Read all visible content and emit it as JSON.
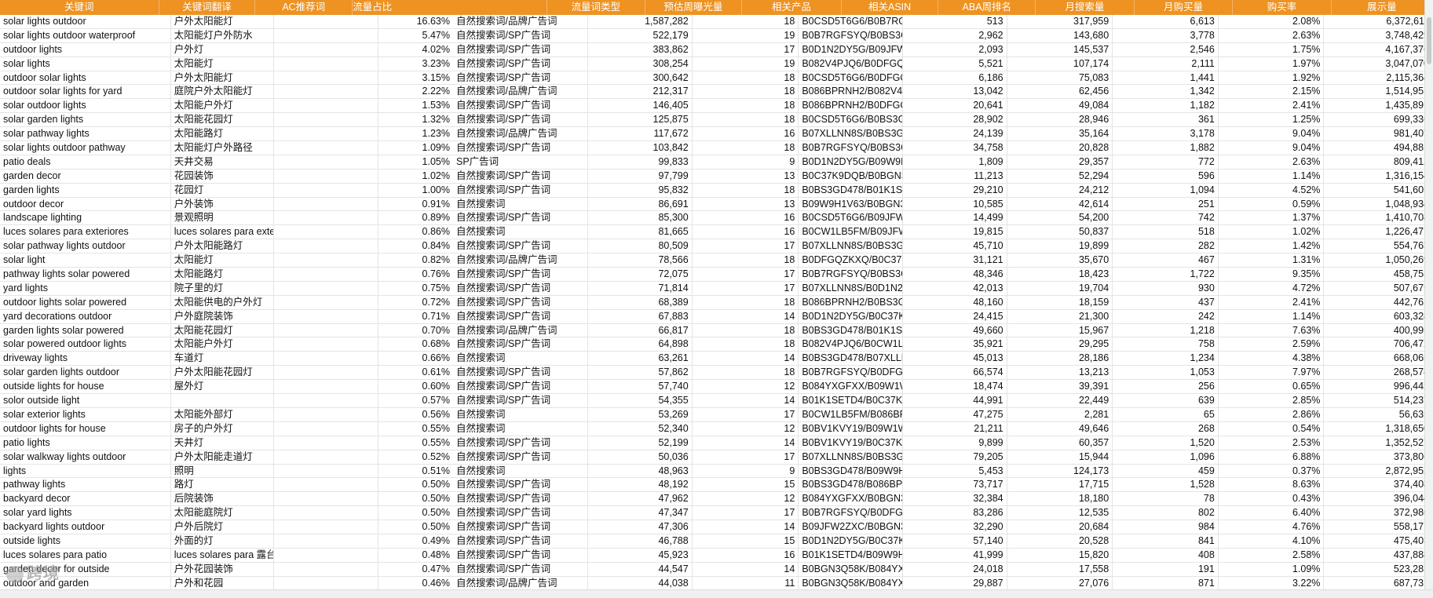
{
  "headers": [
    "关键词",
    "关键词翻译",
    "AC推荐词",
    "流量占比",
    "流量词类型",
    "预估周曝光量",
    "相关产品",
    "相关ASIN",
    "ABA周排名",
    "月搜索量",
    "月购买量",
    "购买率",
    "展示量"
  ],
  "rows": [
    [
      "solar lights outdoor",
      "户外太阳能灯",
      "",
      "16.63%",
      "自然搜索词/品牌广告词",
      "1,587,282",
      "18",
      "B0CSD5T6G6/B0B7RGF",
      "513",
      "317,959",
      "6,613",
      "2.08%",
      "6,372,611"
    ],
    [
      "solar lights outdoor waterproof",
      "太阳能灯户外防水",
      "",
      "5.47%",
      "自然搜索词/SP广告词",
      "522,179",
      "19",
      "B0B7RGFSYQ/B0BS3GD",
      "2,962",
      "143,680",
      "3,778",
      "2.63%",
      "3,748,429"
    ],
    [
      "outdoor lights",
      "户外灯",
      "",
      "4.02%",
      "自然搜索词/SP广告词",
      "383,862",
      "17",
      "B0D1N2DY5G/B09JFW2",
      "2,093",
      "145,537",
      "2,546",
      "1.75%",
      "4,167,376"
    ],
    [
      "solar lights",
      "太阳能灯",
      "",
      "3.23%",
      "自然搜索词/SP广告词",
      "308,254",
      "19",
      "B082V4PJQ6/B0DFGQZ",
      "5,521",
      "107,174",
      "2,111",
      "1.97%",
      "3,047,070"
    ],
    [
      "outdoor solar lights",
      "户外太阳能灯",
      "",
      "3.15%",
      "自然搜索词/SP广告词",
      "300,642",
      "18",
      "B0CSD5T6G6/B0DFGQZ",
      "6,186",
      "75,083",
      "1,441",
      "1.92%",
      "2,115,364"
    ],
    [
      "outdoor solar lights for yard",
      "庭院户外太阳能灯",
      "",
      "2.22%",
      "自然搜索词/品牌广告词",
      "212,317",
      "18",
      "B086BPRNH2/B082V4P",
      "13,042",
      "62,456",
      "1,342",
      "2.15%",
      "1,514,951"
    ],
    [
      "solar outdoor lights",
      "太阳能户外灯",
      "",
      "1.53%",
      "自然搜索词/SP广告词",
      "146,405",
      "18",
      "B086BPRNH2/B0DFGQZ",
      "20,641",
      "49,084",
      "1,182",
      "2.41%",
      "1,435,891"
    ],
    [
      "solar garden lights",
      "太阳能花园灯",
      "",
      "1.32%",
      "自然搜索词/SP广告词",
      "125,875",
      "18",
      "B0CSD5T6G6/B0BS3GD",
      "28,902",
      "28,946",
      "361",
      "1.25%",
      "699,336"
    ],
    [
      "solar pathway lights",
      "太阳能路灯",
      "",
      "1.23%",
      "自然搜索词/品牌广告词",
      "117,672",
      "16",
      "B07XLLNN8S/B0BS3GD",
      "24,139",
      "35,164",
      "3,178",
      "9.04%",
      "981,407"
    ],
    [
      "solar lights outdoor pathway",
      "太阳能灯户外路径",
      "",
      "1.09%",
      "自然搜索词/SP广告词",
      "103,842",
      "18",
      "B0B7RGFSYQ/B0BS3GD",
      "34,758",
      "20,828",
      "1,882",
      "9.04%",
      "494,881"
    ],
    [
      "patio deals",
      "天井交易",
      "",
      "1.05%",
      "SP广告词",
      "99,833",
      "9",
      "B0D1N2DY5G/B09W9H",
      "1,809",
      "29,357",
      "772",
      "2.63%",
      "809,412"
    ],
    [
      "garden decor",
      "花园装饰",
      "",
      "1.02%",
      "自然搜索词/SP广告词",
      "97,799",
      "13",
      "B0C37K9DQB/B0BGN3C",
      "11,213",
      "52,294",
      "596",
      "1.14%",
      "1,316,154"
    ],
    [
      "garden lights",
      "花园灯",
      "",
      "1.00%",
      "自然搜索词/SP广告词",
      "95,832",
      "18",
      "B0BS3GD478/B01K1SET",
      "29,210",
      "24,212",
      "1,094",
      "4.52%",
      "541,605"
    ],
    [
      "outdoor decor",
      "户外装饰",
      "",
      "0.91%",
      "自然搜索词",
      "86,691",
      "13",
      "B09W9H1V63/B0BGN3C",
      "10,585",
      "42,614",
      "251",
      "0.59%",
      "1,048,934"
    ],
    [
      "landscape lighting",
      "景观照明",
      "",
      "0.89%",
      "自然搜索词/SP广告词",
      "85,300",
      "16",
      "B0CSD5T6G6/B09JFW2",
      "14,499",
      "54,200",
      "742",
      "1.37%",
      "1,410,708"
    ],
    [
      "luces solares para exteriores",
      "luces solares para exter",
      "",
      "0.86%",
      "自然搜索词",
      "81,665",
      "16",
      "B0CW1LB5FM/B09JFW2",
      "19,815",
      "50,837",
      "518",
      "1.02%",
      "1,226,471"
    ],
    [
      "solar pathway lights outdoor",
      "户外太阳能路灯",
      "",
      "0.84%",
      "自然搜索词/SP广告词",
      "80,509",
      "17",
      "B07XLLNN8S/B0BS3GD",
      "45,710",
      "19,899",
      "282",
      "1.42%",
      "554,763"
    ],
    [
      "solar light",
      "太阳能灯",
      "",
      "0.82%",
      "自然搜索词/品牌广告词",
      "78,566",
      "18",
      "B0DFGQZKXQ/B0C37K9",
      "31,121",
      "35,670",
      "467",
      "1.31%",
      "1,050,269"
    ],
    [
      "pathway lights solar powered",
      "太阳能路灯",
      "",
      "0.76%",
      "自然搜索词/SP广告词",
      "72,075",
      "17",
      "B0B7RGFSYQ/B0BS3GD",
      "48,346",
      "18,423",
      "1,722",
      "9.35%",
      "458,753"
    ],
    [
      "yard lights",
      "院子里的灯",
      "",
      "0.75%",
      "自然搜索词/SP广告词",
      "71,814",
      "17",
      "B07XLLNN8S/B0D1N2D",
      "42,013",
      "19,704",
      "930",
      "4.72%",
      "507,675"
    ],
    [
      "outdoor lights solar powered",
      "太阳能供电的户外灯",
      "",
      "0.72%",
      "自然搜索词/SP广告词",
      "68,389",
      "18",
      "B086BPRNH2/B0BS3GD",
      "48,160",
      "18,159",
      "437",
      "2.41%",
      "442,761"
    ],
    [
      "yard decorations outdoor",
      "户外庭院装饰",
      "",
      "0.71%",
      "自然搜索词/SP广告词",
      "67,883",
      "14",
      "B0D1N2DY5G/B0C37K9",
      "24,415",
      "21,300",
      "242",
      "1.14%",
      "603,328"
    ],
    [
      "garden lights solar powered",
      "太阳能花园灯",
      "",
      "0.70%",
      "自然搜索词/品牌广告词",
      "66,817",
      "18",
      "B0BS3GD478/B01K1SET",
      "49,660",
      "15,967",
      "1,218",
      "7.63%",
      "400,995"
    ],
    [
      "solar powered outdoor lights",
      "太阳能户外灯",
      "",
      "0.68%",
      "自然搜索词/SP广告词",
      "64,898",
      "18",
      "B082V4PJQ6/B0CW1LB",
      "35,921",
      "29,295",
      "758",
      "2.59%",
      "706,472"
    ],
    [
      "driveway lights",
      "车道灯",
      "",
      "0.66%",
      "自然搜索词",
      "63,261",
      "14",
      "B0BS3GD478/B07XLLN",
      "45,013",
      "28,186",
      "1,234",
      "4.38%",
      "668,065"
    ],
    [
      "solar garden lights outdoor",
      "户外太阳能花园灯",
      "",
      "0.61%",
      "自然搜索词/SP广告词",
      "57,862",
      "18",
      "B0B7RGFSYQ/B0DFGQZ",
      "66,574",
      "13,213",
      "1,053",
      "7.97%",
      "268,578"
    ],
    [
      "outside lights for house",
      "屋外灯",
      "",
      "0.60%",
      "自然搜索词/SP广告词",
      "57,740",
      "12",
      "B084YXGFXX/B09W1WI",
      "18,474",
      "39,391",
      "256",
      "0.65%",
      "996,442"
    ],
    [
      "solor outside light",
      "",
      "",
      "0.57%",
      "自然搜索词/SP广告词",
      "54,355",
      "14",
      "B01K1SETD4/B0C37K9D",
      "44,991",
      "22,449",
      "639",
      "2.85%",
      "514,237"
    ],
    [
      "solar exterior lights",
      "太阳能外部灯",
      "",
      "0.56%",
      "自然搜索词",
      "53,269",
      "17",
      "B0CW1LB5FM/B086BPR",
      "47,275",
      "2,281",
      "65",
      "2.86%",
      "56,635"
    ],
    [
      "outdoor lights for house",
      "房子的户外灯",
      "",
      "0.55%",
      "自然搜索词",
      "52,340",
      "12",
      "B0BV1KVY19/B09W1WI",
      "21,211",
      "49,646",
      "268",
      "0.54%",
      "1,318,650"
    ],
    [
      "patio lights",
      "天井灯",
      "",
      "0.55%",
      "自然搜索词/SP广告词",
      "52,199",
      "14",
      "B0BV1KVY19/B0C37K9D",
      "9,899",
      "60,357",
      "1,520",
      "2.53%",
      "1,352,527"
    ],
    [
      "solar walkway lights outdoor",
      "户外太阳能走道灯",
      "",
      "0.52%",
      "自然搜索词/SP广告词",
      "50,036",
      "17",
      "B07XLLNN8S/B0BS3GD",
      "79,205",
      "15,944",
      "1,096",
      "6.88%",
      "373,806"
    ],
    [
      "lights",
      "照明",
      "",
      "0.51%",
      "自然搜索词",
      "48,963",
      "9",
      "B0BS3GD478/B09W9H1",
      "5,453",
      "124,173",
      "459",
      "0.37%",
      "2,872,952"
    ],
    [
      "pathway lights",
      "路灯",
      "",
      "0.50%",
      "自然搜索词/SP广告词",
      "48,192",
      "15",
      "B0BS3GD478/B086BPRI",
      "73,717",
      "17,715",
      "1,528",
      "8.63%",
      "374,408"
    ],
    [
      "backyard decor",
      "后院装饰",
      "",
      "0.50%",
      "自然搜索词/SP广告词",
      "47,962",
      "12",
      "B084YXGFXX/B0BGN3Q",
      "32,384",
      "18,180",
      "78",
      "0.43%",
      "396,044"
    ],
    [
      "solar yard lights",
      "太阳能庭院灯",
      "",
      "0.50%",
      "自然搜索词/SP广告词",
      "47,347",
      "17",
      "B0B7RGFSYQ/B0DFGQZ",
      "83,286",
      "12,535",
      "802",
      "6.40%",
      "372,986"
    ],
    [
      "backyard lights outdoor",
      "户外后院灯",
      "",
      "0.50%",
      "自然搜索词/SP广告词",
      "47,306",
      "14",
      "B09JFW2ZXC/B0BGN3Q",
      "32,290",
      "20,684",
      "984",
      "4.76%",
      "558,171"
    ],
    [
      "outside lights",
      "外面的灯",
      "",
      "0.49%",
      "自然搜索词/SP广告词",
      "46,788",
      "15",
      "B0D1N2DY5G/B0C37K9",
      "57,140",
      "20,528",
      "841",
      "4.10%",
      "475,403"
    ],
    [
      "luces solares para patio",
      "luces solares para 露台",
      "",
      "0.48%",
      "自然搜索词/SP广告词",
      "45,923",
      "16",
      "B01K1SETD4/B09W9H1",
      "41,999",
      "15,820",
      "408",
      "2.58%",
      "437,888"
    ],
    [
      "garden decor for outside",
      "户外花园装饰",
      "",
      "0.47%",
      "自然搜索词/SP广告词",
      "44,547",
      "14",
      "B0BGN3Q58K/B084YXG",
      "24,018",
      "17,558",
      "191",
      "1.09%",
      "523,283"
    ],
    [
      "outdoor and garden",
      "户外和花园",
      "",
      "0.46%",
      "自然搜索词/品牌广告词",
      "44,038",
      "11",
      "B0BGN3Q58K/B084YXG",
      "29,887",
      "27,076",
      "871",
      "3.22%",
      "687,731"
    ]
  ],
  "watermark": "跨境"
}
